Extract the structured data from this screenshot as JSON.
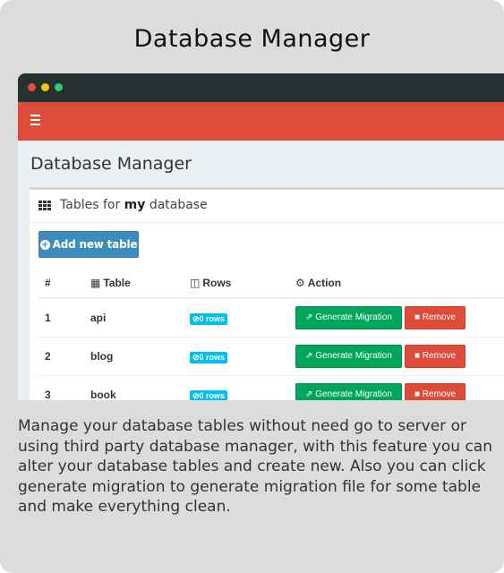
{
  "card": {
    "title": "Database Manager",
    "description": "Manage your database tables without need go to server or using third party database manager, with this feature you can alter your database tables and create new. Also you can click generate migration to generate migration file for some table and make everything clean."
  },
  "browser": {
    "dots": [
      "red",
      "yellow",
      "green"
    ]
  },
  "app": {
    "menu_icon": "hamburger-icon",
    "page_title": "Database Manager",
    "box": {
      "title_prefix": "Tables for ",
      "title_db": "my",
      "title_suffix": " database",
      "add_button": "Add new table",
      "columns": [
        "#",
        "Table",
        "Rows",
        "Action"
      ],
      "rows": [
        {
          "num": "1",
          "table": "api",
          "rows": "0 rows",
          "generate": "Generate Migration",
          "remove": "Remove"
        },
        {
          "num": "2",
          "table": "blog",
          "rows": "0 rows",
          "generate": "Generate Migration",
          "remove": "Remove"
        },
        {
          "num": "3",
          "table": "book",
          "rows": "0 rows",
          "generate": "Generate Migration",
          "remove": "Remove"
        }
      ]
    }
  },
  "colors": {
    "appbar": "#dd4b39",
    "titlebar": "#263232",
    "primary": "#3c8dbc",
    "success": "#00a65a",
    "danger": "#dd4b39",
    "info": "#00c0ef"
  }
}
